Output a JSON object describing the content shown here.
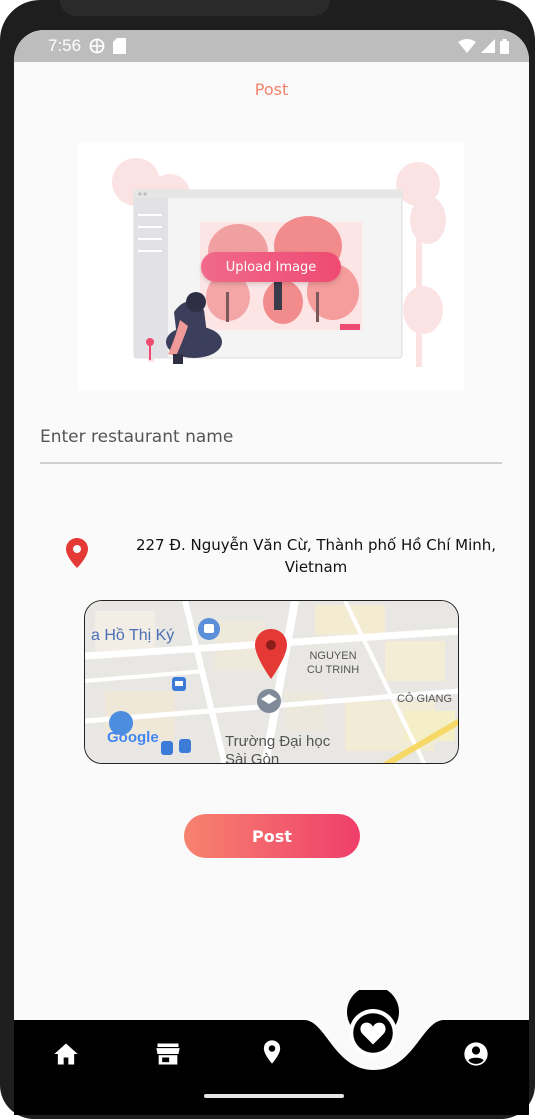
{
  "status_bar": {
    "time": "7:56"
  },
  "app_bar": {
    "title": "Post"
  },
  "upload": {
    "button_label": "Upload Image"
  },
  "form": {
    "restaurant_name_placeholder": "Enter restaurant name",
    "restaurant_name_value": ""
  },
  "location": {
    "address": "227 Đ. Nguyễn Văn Cừ, Thành phố Hồ Chí Minh, Vietnam"
  },
  "map": {
    "labels": {
      "place_1": "a Hồ Thị Ký",
      "district": "NGUYEN CU TRINH",
      "area": "CÔ GIANG",
      "university": "Trường Đại học Sài Gòn",
      "provider": "Google"
    }
  },
  "actions": {
    "post_label": "Post"
  },
  "bottom_nav": {
    "items": [
      "home-icon",
      "store-icon",
      "location-icon",
      "favorite-icon",
      "profile-icon"
    ],
    "active": "favorite-icon"
  },
  "colors": {
    "accent": "#f4836c",
    "pin_red": "#e53935",
    "nav_bg": "#000000"
  }
}
